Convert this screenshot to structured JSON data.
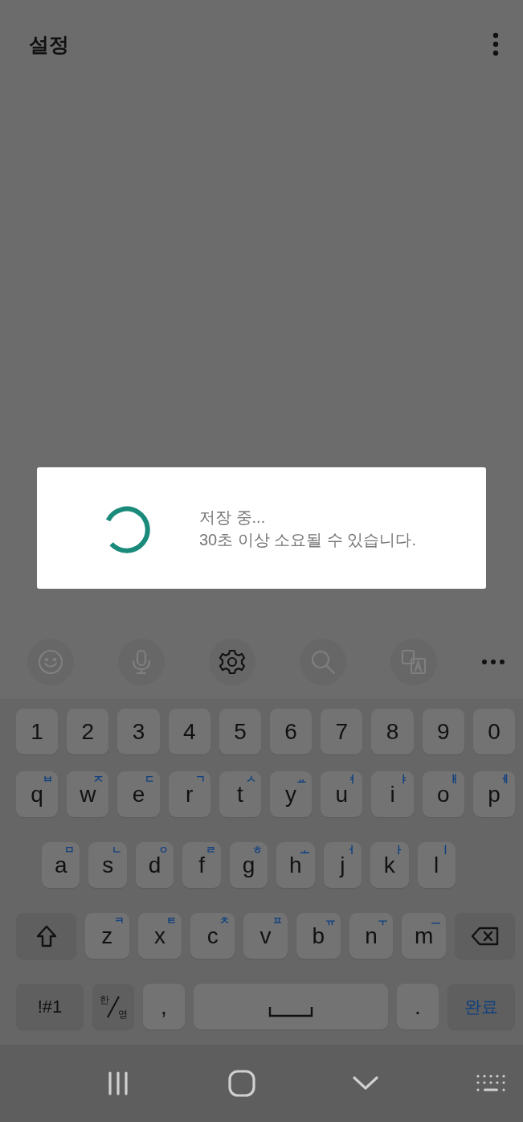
{
  "app_bar": {
    "title": "설정"
  },
  "dialog": {
    "title": "저장 중...",
    "message": "30초 이상 소요될 수 있습니다."
  },
  "toolbar": [
    {
      "kind": "emoji",
      "disabled": true
    },
    {
      "kind": "voice",
      "disabled": true
    },
    {
      "kind": "settings",
      "disabled": false
    },
    {
      "kind": "search",
      "disabled": true
    },
    {
      "kind": "translate",
      "disabled": true
    },
    {
      "kind": "more",
      "disabled": false
    }
  ],
  "keyboard": {
    "rows": [
      [
        {
          "kind": "char",
          "label": "1"
        },
        {
          "kind": "char",
          "label": "2"
        },
        {
          "kind": "char",
          "label": "3"
        },
        {
          "kind": "char",
          "label": "4"
        },
        {
          "kind": "char",
          "label": "5"
        },
        {
          "kind": "char",
          "label": "6"
        },
        {
          "kind": "char",
          "label": "7"
        },
        {
          "kind": "char",
          "label": "8"
        },
        {
          "kind": "char",
          "label": "9"
        },
        {
          "kind": "char",
          "label": "0"
        }
      ],
      [
        {
          "kind": "char",
          "label": "q",
          "hint": "ㅂ"
        },
        {
          "kind": "char",
          "label": "w",
          "hint": "ㅈ"
        },
        {
          "kind": "char",
          "label": "e",
          "hint": "ㄷ"
        },
        {
          "kind": "char",
          "label": "r",
          "hint": "ㄱ"
        },
        {
          "kind": "char",
          "label": "t",
          "hint": "ㅅ"
        },
        {
          "kind": "char",
          "label": "y",
          "hint": "ㅛ"
        },
        {
          "kind": "char",
          "label": "u",
          "hint": "ㅕ"
        },
        {
          "kind": "char",
          "label": "i",
          "hint": "ㅑ"
        },
        {
          "kind": "char",
          "label": "o",
          "hint": "ㅐ"
        },
        {
          "kind": "char",
          "label": "p",
          "hint": "ㅔ"
        }
      ],
      [
        {
          "kind": "char",
          "label": "a",
          "hint": "ㅁ"
        },
        {
          "kind": "char",
          "label": "s",
          "hint": "ㄴ"
        },
        {
          "kind": "char",
          "label": "d",
          "hint": "ㅇ"
        },
        {
          "kind": "char",
          "label": "f",
          "hint": "ㄹ"
        },
        {
          "kind": "char",
          "label": "g",
          "hint": "ㅎ"
        },
        {
          "kind": "char",
          "label": "h",
          "hint": "ㅗ"
        },
        {
          "kind": "char",
          "label": "j",
          "hint": "ㅓ"
        },
        {
          "kind": "char",
          "label": "k",
          "hint": "ㅏ"
        },
        {
          "kind": "char",
          "label": "l",
          "hint": "ㅣ"
        }
      ],
      [
        {
          "kind": "shift"
        },
        {
          "kind": "char",
          "label": "z",
          "hint": "ㅋ"
        },
        {
          "kind": "char",
          "label": "x",
          "hint": "ㅌ"
        },
        {
          "kind": "char",
          "label": "c",
          "hint": "ㅊ"
        },
        {
          "kind": "char",
          "label": "v",
          "hint": "ㅍ"
        },
        {
          "kind": "char",
          "label": "b",
          "hint": "ㅠ"
        },
        {
          "kind": "char",
          "label": "n",
          "hint": "ㅜ"
        },
        {
          "kind": "char",
          "label": "m",
          "hint": "ㅡ"
        },
        {
          "kind": "backspace"
        }
      ],
      [
        {
          "kind": "symbols",
          "label": "!#1"
        },
        {
          "kind": "language",
          "label": "한",
          "hint": "영"
        },
        {
          "kind": "char",
          "label": ","
        },
        {
          "kind": "space"
        },
        {
          "kind": "char",
          "label": "."
        },
        {
          "kind": "done",
          "label": "완료"
        }
      ]
    ]
  }
}
